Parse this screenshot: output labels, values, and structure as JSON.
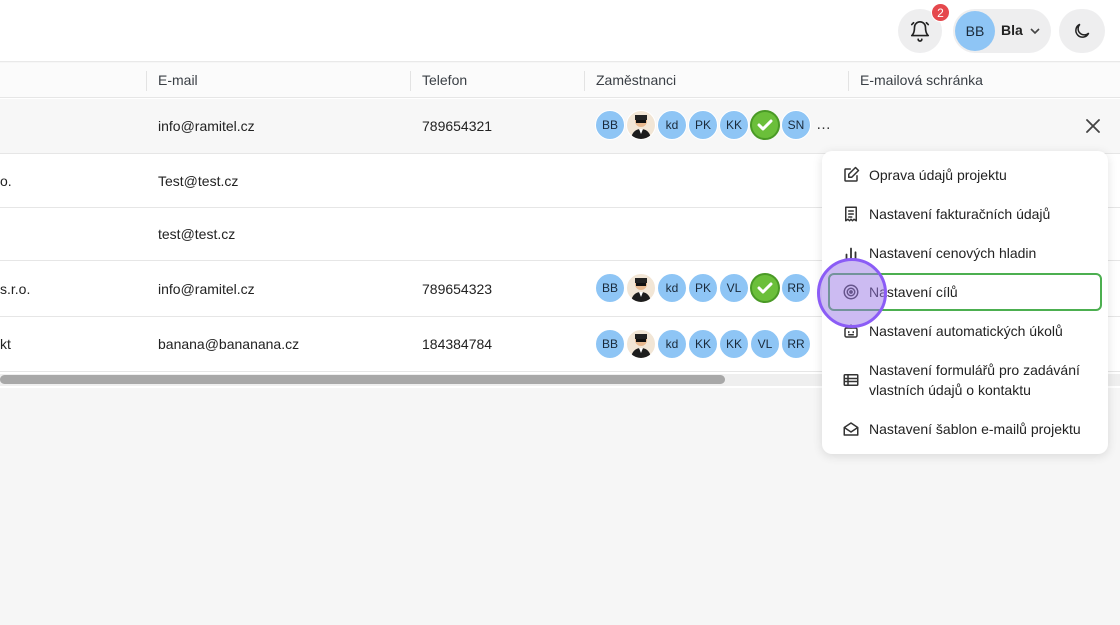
{
  "header": {
    "notifications_count": "2",
    "user_initials": "BB",
    "user_name": "Bla"
  },
  "table": {
    "columns": [
      "E-mail",
      "Telefon",
      "Zaměstnanci",
      "E-mailová schránka"
    ],
    "rows": [
      {
        "name": "",
        "email": "info@ramitel.cz",
        "phone": "789654321",
        "employees": [
          "BB",
          "photo",
          "kd",
          "PK",
          "KK",
          "check",
          "SN"
        ],
        "more": "…"
      },
      {
        "name": "o.",
        "email": "Test@test.cz",
        "phone": "",
        "employees": []
      },
      {
        "name": "",
        "email": "test@test.cz",
        "phone": "",
        "employees": []
      },
      {
        "name": "s.r.o.",
        "email": "info@ramitel.cz",
        "phone": "789654323",
        "employees": [
          "BB",
          "photo",
          "kd",
          "PK",
          "VL",
          "check",
          "RR"
        ]
      },
      {
        "name": "kt",
        "email": "banana@bananana.cz",
        "phone": "184384784",
        "employees": [
          "BB",
          "photo",
          "kd",
          "KK",
          "KK",
          "VL",
          "RR"
        ]
      }
    ]
  },
  "menu": {
    "items": [
      {
        "label": "Oprava údajů projektu",
        "icon": "edit-icon"
      },
      {
        "label": "Nastavení fakturačních údajů",
        "icon": "receipt-icon"
      },
      {
        "label": "Nastavení cenových hladin",
        "icon": "bar-chart-icon"
      },
      {
        "label": "Nastavení cílů",
        "icon": "target-icon",
        "active": true
      },
      {
        "label": "Nastavení automatických úkolů",
        "icon": "robot-icon"
      },
      {
        "label": "Nastavení formulářů pro zadávání vlastních údajů o kontaktu",
        "label_line1": "Nastavení formulářů pro zadávání",
        "label_line2": "vlastních údajů o kontaktu",
        "icon": "table-icon"
      },
      {
        "label": "Nastavení šablon e-mailů projektu",
        "icon": "mail-open-icon"
      }
    ]
  },
  "colors": {
    "accent_active": "#4caf50",
    "avatar_bg": "#8ec5f5",
    "badge": "#e5484d",
    "cursor": "#8b5cf6"
  }
}
